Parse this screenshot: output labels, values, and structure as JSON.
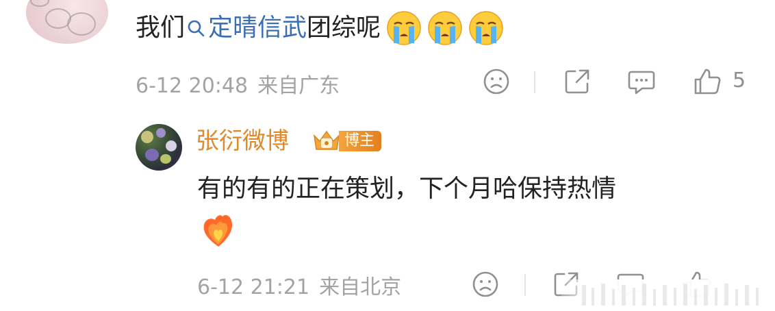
{
  "comment": {
    "text_before": "我们",
    "topic": "定晴信武",
    "text_after": "团综呢",
    "emojis": [
      "crying-face",
      "crying-face",
      "crying-face"
    ],
    "date": "6-12 20:48",
    "location": "来自广东",
    "like_count": "5"
  },
  "reply": {
    "author": "张衍微博",
    "badge": "博主",
    "text": "有的有的正在策划，下个月哈保持热情",
    "emoji": "heart-on-fire",
    "date": "6-12 21:21",
    "location": "来自北京"
  },
  "colors": {
    "topic_link": "#3a6fb5",
    "author_name": "#e0892a",
    "meta_text": "#a3a3a3"
  }
}
